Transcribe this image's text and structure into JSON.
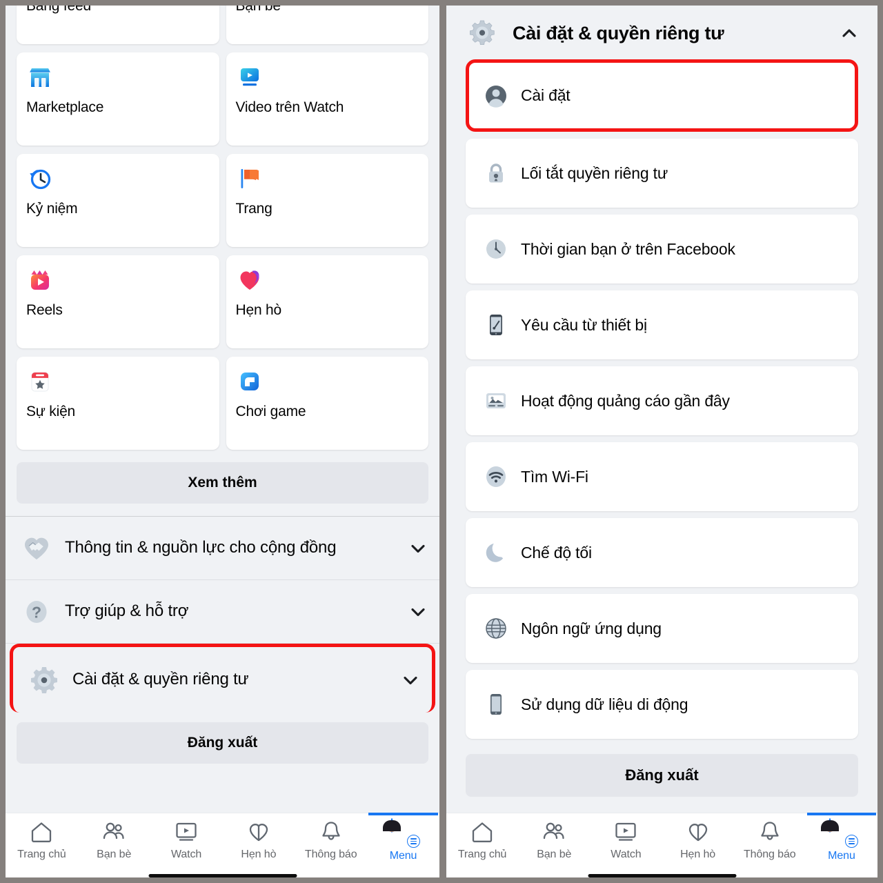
{
  "left_panel": {
    "grid_items": [
      {
        "label": "Bảng feed",
        "icon": "feed-icon"
      },
      {
        "label": "Bạn bè",
        "icon": "friends-icon"
      },
      {
        "label": "Marketplace",
        "icon": "marketplace-icon"
      },
      {
        "label": "Video trên Watch",
        "icon": "watch-video-icon"
      },
      {
        "label": "Kỷ niệm",
        "icon": "memories-clock-icon"
      },
      {
        "label": "Trang",
        "icon": "pages-flag-icon"
      },
      {
        "label": "Reels",
        "icon": "reels-icon"
      },
      {
        "label": "Hẹn hò",
        "icon": "dating-heart-icon"
      },
      {
        "label": "Sự kiện",
        "icon": "events-calendar-icon"
      },
      {
        "label": "Chơi game",
        "icon": "gaming-icon"
      }
    ],
    "see_more_label": "Xem thêm",
    "accordions": [
      {
        "label": "Thông tin & nguồn lực cho cộng đồng",
        "icon": "handshake-heart-icon",
        "chevron": "chevron-down",
        "highlighted": false
      },
      {
        "label": "Trợ giúp & hỗ trợ",
        "icon": "question-mark-icon",
        "chevron": "chevron-down",
        "highlighted": false
      },
      {
        "label": "Cài đặt & quyền riêng tư",
        "icon": "gear-icon",
        "chevron": "chevron-down",
        "highlighted": true
      }
    ],
    "logout_label": "Đăng xuất"
  },
  "right_panel": {
    "header": {
      "title": "Cài đặt & quyền riêng tư",
      "icon": "gear-icon",
      "chevron": "chevron-up"
    },
    "items": [
      {
        "label": "Cài đặt",
        "icon": "person-circle-icon",
        "highlighted": true
      },
      {
        "label": "Lối tắt quyền riêng tư",
        "icon": "lock-icon",
        "highlighted": false
      },
      {
        "label": "Thời gian bạn ở trên Facebook",
        "icon": "clock-icon",
        "highlighted": false
      },
      {
        "label": "Yêu cầu từ thiết bị",
        "icon": "phone-request-icon",
        "highlighted": false
      },
      {
        "label": "Hoạt động quảng cáo gần đây",
        "icon": "ad-activity-icon",
        "highlighted": false
      },
      {
        "label": "Tìm Wi-Fi",
        "icon": "wifi-icon",
        "highlighted": false
      },
      {
        "label": "Chế độ tối",
        "icon": "moon-icon",
        "highlighted": false
      },
      {
        "label": "Ngôn ngữ ứng dụng",
        "icon": "globe-icon",
        "highlighted": false
      },
      {
        "label": "Sử dụng dữ liệu di động",
        "icon": "mobile-data-icon",
        "highlighted": false
      }
    ],
    "logout_label": "Đăng xuất"
  },
  "bottom_nav": {
    "items": [
      {
        "label": "Trang chủ",
        "icon": "home-icon",
        "active": false
      },
      {
        "label": "Bạn bè",
        "icon": "friends-icon",
        "active": false
      },
      {
        "label": "Watch",
        "icon": "watch-play-icon",
        "active": false
      },
      {
        "label": "Hẹn hò",
        "icon": "dating-heart-icon",
        "active": false
      },
      {
        "label": "Thông báo",
        "icon": "bell-icon",
        "active": false
      },
      {
        "label": "Menu",
        "icon": "avatar-menu-icon",
        "active": true
      }
    ]
  },
  "colors": {
    "highlight_red": "#f41414",
    "facebook_blue": "#1877f2",
    "panel_background": "#f0f2f5",
    "card_background": "#ffffff",
    "pill_background": "#e4e6eb",
    "divider_gray": "#85807d"
  }
}
